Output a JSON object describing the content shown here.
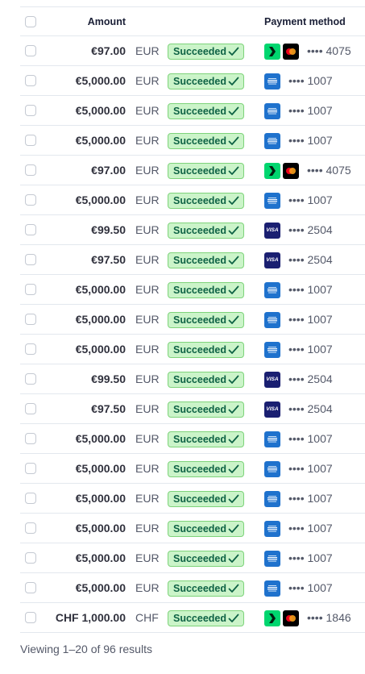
{
  "header": {
    "amount_label": "Amount",
    "payment_method_label": "Payment method"
  },
  "rows": [
    {
      "amount": "€97.00",
      "currency": "EUR",
      "status": "Succeeded",
      "brand": "link+mastercard",
      "last4": "•••• 4075"
    },
    {
      "amount": "€5,000.00",
      "currency": "EUR",
      "status": "Succeeded",
      "brand": "amex",
      "last4": "•••• 1007"
    },
    {
      "amount": "€5,000.00",
      "currency": "EUR",
      "status": "Succeeded",
      "brand": "amex",
      "last4": "•••• 1007"
    },
    {
      "amount": "€5,000.00",
      "currency": "EUR",
      "status": "Succeeded",
      "brand": "amex",
      "last4": "•••• 1007"
    },
    {
      "amount": "€97.00",
      "currency": "EUR",
      "status": "Succeeded",
      "brand": "link+mastercard",
      "last4": "•••• 4075"
    },
    {
      "amount": "€5,000.00",
      "currency": "EUR",
      "status": "Succeeded",
      "brand": "amex",
      "last4": "•••• 1007"
    },
    {
      "amount": "€99.50",
      "currency": "EUR",
      "status": "Succeeded",
      "brand": "visa",
      "last4": "•••• 2504"
    },
    {
      "amount": "€97.50",
      "currency": "EUR",
      "status": "Succeeded",
      "brand": "visa",
      "last4": "•••• 2504"
    },
    {
      "amount": "€5,000.00",
      "currency": "EUR",
      "status": "Succeeded",
      "brand": "amex",
      "last4": "•••• 1007"
    },
    {
      "amount": "€5,000.00",
      "currency": "EUR",
      "status": "Succeeded",
      "brand": "amex",
      "last4": "•••• 1007"
    },
    {
      "amount": "€5,000.00",
      "currency": "EUR",
      "status": "Succeeded",
      "brand": "amex",
      "last4": "•••• 1007"
    },
    {
      "amount": "€99.50",
      "currency": "EUR",
      "status": "Succeeded",
      "brand": "visa",
      "last4": "•••• 2504"
    },
    {
      "amount": "€97.50",
      "currency": "EUR",
      "status": "Succeeded",
      "brand": "visa",
      "last4": "•••• 2504"
    },
    {
      "amount": "€5,000.00",
      "currency": "EUR",
      "status": "Succeeded",
      "brand": "amex",
      "last4": "•••• 1007"
    },
    {
      "amount": "€5,000.00",
      "currency": "EUR",
      "status": "Succeeded",
      "brand": "amex",
      "last4": "•••• 1007"
    },
    {
      "amount": "€5,000.00",
      "currency": "EUR",
      "status": "Succeeded",
      "brand": "amex",
      "last4": "•••• 1007"
    },
    {
      "amount": "€5,000.00",
      "currency": "EUR",
      "status": "Succeeded",
      "brand": "amex",
      "last4": "•••• 1007"
    },
    {
      "amount": "€5,000.00",
      "currency": "EUR",
      "status": "Succeeded",
      "brand": "amex",
      "last4": "•••• 1007"
    },
    {
      "amount": "€5,000.00",
      "currency": "EUR",
      "status": "Succeeded",
      "brand": "amex",
      "last4": "•••• 1007"
    },
    {
      "amount": "CHF 1,000.00",
      "currency": "CHF",
      "status": "Succeeded",
      "brand": "link+mastercard",
      "last4": "•••• 1846"
    }
  ],
  "footer": {
    "summary": "Viewing 1–20 of 96 results"
  },
  "colors": {
    "success_bg": "#cbf4c9",
    "success_text": "#0e6245",
    "link": "#00d66f",
    "amex": "#1f72cd",
    "visa": "#1a1f71"
  },
  "icons": {
    "visa_text": "VISA"
  }
}
